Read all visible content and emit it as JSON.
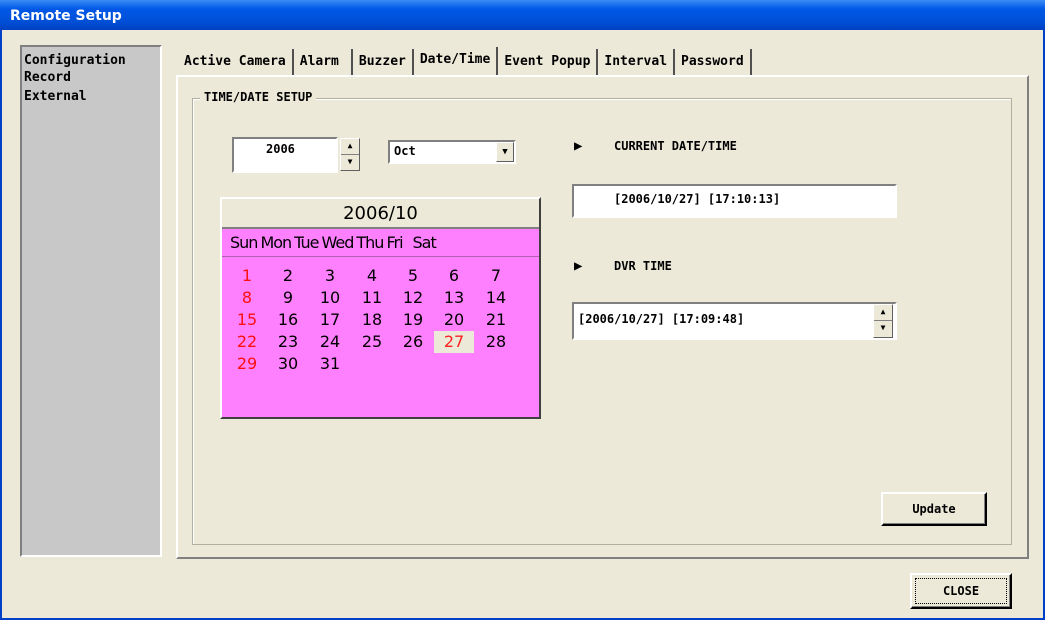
{
  "window": {
    "title": "Remote Setup"
  },
  "sidebar": {
    "items": [
      "Configuration",
      "Record",
      "External"
    ]
  },
  "tabs": [
    {
      "label": "Active Camera"
    },
    {
      "label": "Alarm"
    },
    {
      "label": "Buzzer"
    },
    {
      "label": "Date/Time",
      "active": true
    },
    {
      "label": "Event Popup"
    },
    {
      "label": "Interval"
    },
    {
      "label": "Password"
    }
  ],
  "group": {
    "title": "TIME/DATE SETUP"
  },
  "year": {
    "value": "2006"
  },
  "month": {
    "value": "Oct"
  },
  "calendar": {
    "header": "2006/10",
    "weekdays": [
      "Sun",
      "Mon",
      "Tue",
      "Wed",
      "Thu",
      "Fri",
      "Sat"
    ],
    "today": "27",
    "weeks": [
      [
        "1",
        "2",
        "3",
        "4",
        "5",
        "6",
        "7"
      ],
      [
        "8",
        "9",
        "10",
        "11",
        "12",
        "13",
        "14"
      ],
      [
        "15",
        "16",
        "17",
        "18",
        "19",
        "20",
        "21"
      ],
      [
        "22",
        "23",
        "24",
        "25",
        "26",
        "27",
        "28"
      ],
      [
        "29",
        "30",
        "31"
      ]
    ]
  },
  "current": {
    "label": "CURRENT DATE/TIME",
    "value": "[2006/10/27] [17:10:13]"
  },
  "dvr": {
    "label": "DVR TIME",
    "value": "[2006/10/27] [17:09:48]"
  },
  "buttons": {
    "update": "Update",
    "close": "CLOSE"
  },
  "colors": {
    "calendar_bg": "#ff80ff",
    "sunday": "#ff1010",
    "titlebar": "#0058e6"
  }
}
